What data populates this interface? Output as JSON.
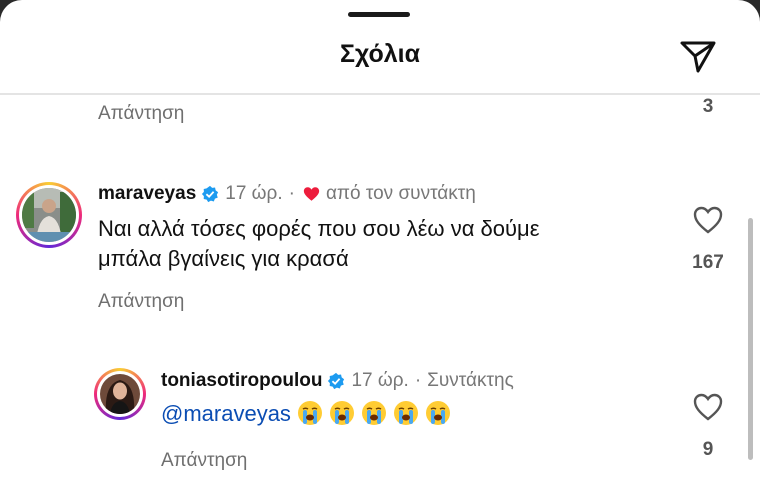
{
  "header": {
    "title": "Σχόλια",
    "share_icon": "paper-plane-icon"
  },
  "top_comment": {
    "reply_label": "Απάντηση",
    "like_count": "3"
  },
  "comment": {
    "username": "maraveyas",
    "time": "17 ώρ.",
    "separator": "·",
    "liked_by_creator": "από τον συντάκτη",
    "text_line1": "Ναι αλλά τόσες φορές που σου λέω να δούμε",
    "text_line2": "μπάλα βγαίνεις για κρασά",
    "like_count": "167",
    "reply_label": "Απάντηση"
  },
  "reply": {
    "username": "toniasotiropoulou",
    "time": "17 ώρ.",
    "separator": "·",
    "role": "Συντάκτης",
    "mention": "@maraveyas",
    "emojis": [
      "loudly-crying-face",
      "loudly-crying-face",
      "loudly-crying-face",
      "loudly-crying-face",
      "loudly-crying-face"
    ],
    "like_count": "9",
    "reply_label": "Απάντηση"
  },
  "colors": {
    "accent_link": "#0b4db3",
    "heart_red": "#ed1c3c",
    "verified_blue": "#1d9bf0"
  }
}
